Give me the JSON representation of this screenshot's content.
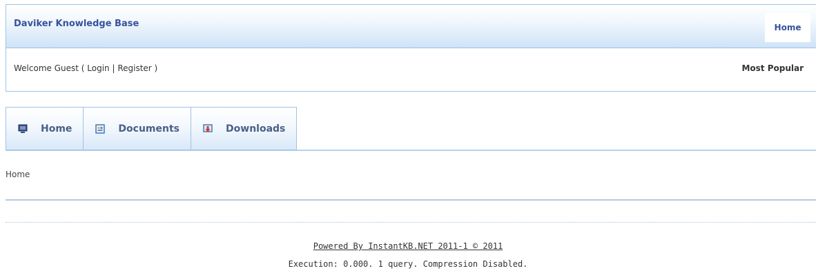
{
  "header": {
    "site_title": "Daviker Knowledge Base",
    "home_link": "Home"
  },
  "welcome": {
    "prefix": "Welcome Guest ( ",
    "login_label": "Login",
    "separator": " | ",
    "register_label": "Register",
    "suffix": " )",
    "most_popular_label": "Most Popular"
  },
  "nav": {
    "tabs": [
      {
        "label": "Home",
        "icon": "monitor-icon"
      },
      {
        "label": "Documents",
        "icon": "documents-icon"
      },
      {
        "label": "Downloads",
        "icon": "download-icon"
      }
    ]
  },
  "breadcrumb": {
    "current": "Home"
  },
  "footer": {
    "powered_by": "Powered By InstantKB.NET 2011-1 © 2011",
    "execution": "Execution: 0.000. 1 query. Compression Disabled."
  },
  "colors": {
    "title_blue": "#36529b",
    "border_blue": "#9ec3e6",
    "gradient_blue": "#cfe3f7"
  }
}
